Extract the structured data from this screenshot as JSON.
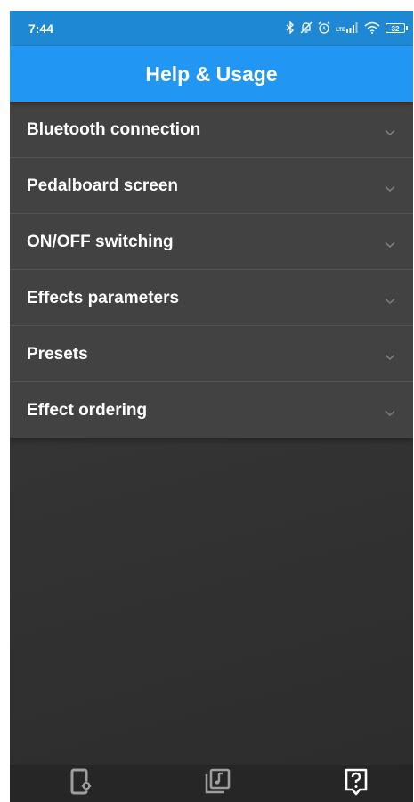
{
  "status_bar": {
    "time": "7:44",
    "network_label": "LTE",
    "battery": "32",
    "icons": [
      "bluetooth-icon",
      "mute-icon",
      "alarm-icon",
      "signal-icon",
      "wifi-icon",
      "battery-icon"
    ]
  },
  "app_bar": {
    "title": "Help & Usage",
    "color": "#2196f3"
  },
  "help_sections": [
    {
      "label": "Bluetooth connection",
      "expanded": false
    },
    {
      "label": "Pedalboard screen",
      "expanded": false
    },
    {
      "label": "ON/OFF switching",
      "expanded": false
    },
    {
      "label": "Effects parameters",
      "expanded": false
    },
    {
      "label": "Presets",
      "expanded": false
    },
    {
      "label": "Effect ordering",
      "expanded": false
    }
  ],
  "bottom_nav": {
    "items": [
      {
        "icon": "device-settings-icon",
        "selected": false
      },
      {
        "icon": "music-library-icon",
        "selected": false
      },
      {
        "icon": "help-icon",
        "selected": true
      }
    ]
  }
}
